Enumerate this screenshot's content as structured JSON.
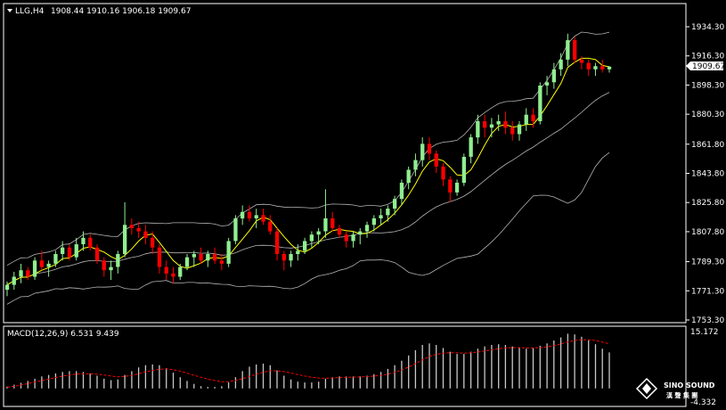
{
  "header": {
    "symbol": "LLG,H4",
    "ohlc": "1908.44 1910.16 1906.18 1909.67"
  },
  "price_axis": {
    "ticks": [
      "1934.30",
      "1916.30",
      "1898.30",
      "1880.30",
      "1861.80",
      "1843.80",
      "1825.80",
      "1807.80",
      "1789.30",
      "1771.30",
      "1753.30"
    ],
    "current_price": "1909.67"
  },
  "macd_panel": {
    "label": "MACD(12,26,9) 6.531 9.439",
    "top_label": "15.172",
    "bottom_label": "-4.332"
  },
  "watermark": {
    "brand": "SINO SOUND",
    "brand_cn": "漢 聲 集 團"
  },
  "colors": {
    "background": "#000000",
    "up_candle": "#90ee90",
    "down_candle": "#ff0000",
    "ma": "#ffff00",
    "bands": "#b4b4b4",
    "macd_hist": "#c8c8c8",
    "macd_signal": "#ff0000"
  },
  "chart_data": [
    {
      "type": "candlestick",
      "y_axis_range": [
        1753.3,
        1945.0
      ],
      "indicators": [
        "Moving Average",
        "Bollinger Bands"
      ],
      "candles": [
        [
          1772,
          1777,
          1768,
          1775
        ],
        [
          1775,
          1783,
          1772,
          1780
        ],
        [
          1780,
          1788,
          1776,
          1784
        ],
        [
          1784,
          1786,
          1778,
          1780
        ],
        [
          1780,
          1792,
          1778,
          1790
        ],
        [
          1790,
          1796,
          1784,
          1786
        ],
        [
          1786,
          1790,
          1780,
          1788
        ],
        [
          1788,
          1796,
          1786,
          1794
        ],
        [
          1794,
          1802,
          1790,
          1798
        ],
        [
          1798,
          1800,
          1790,
          1792
        ],
        [
          1792,
          1804,
          1790,
          1800
        ],
        [
          1800,
          1808,
          1796,
          1804
        ],
        [
          1804,
          1806,
          1796,
          1798
        ],
        [
          1798,
          1800,
          1788,
          1790
        ],
        [
          1790,
          1792,
          1780,
          1784
        ],
        [
          1784,
          1790,
          1778,
          1786
        ],
        [
          1786,
          1796,
          1782,
          1794
        ],
        [
          1794,
          1826,
          1792,
          1812
        ],
        [
          1812,
          1816,
          1806,
          1810
        ],
        [
          1810,
          1814,
          1804,
          1808
        ],
        [
          1808,
          1812,
          1800,
          1804
        ],
        [
          1804,
          1808,
          1794,
          1798
        ],
        [
          1798,
          1800,
          1782,
          1786
        ],
        [
          1786,
          1790,
          1778,
          1782
        ],
        [
          1782,
          1786,
          1776,
          1780
        ],
        [
          1780,
          1788,
          1778,
          1786
        ],
        [
          1786,
          1794,
          1784,
          1792
        ],
        [
          1792,
          1796,
          1786,
          1794
        ],
        [
          1794,
          1798,
          1788,
          1790
        ],
        [
          1790,
          1796,
          1786,
          1794
        ],
        [
          1794,
          1798,
          1788,
          1790
        ],
        [
          1790,
          1794,
          1784,
          1788
        ],
        [
          1788,
          1804,
          1786,
          1802
        ],
        [
          1802,
          1818,
          1800,
          1816
        ],
        [
          1816,
          1824,
          1812,
          1820
        ],
        [
          1820,
          1824,
          1814,
          1816
        ],
        [
          1816,
          1822,
          1810,
          1818
        ],
        [
          1818,
          1822,
          1812,
          1814
        ],
        [
          1814,
          1818,
          1806,
          1808
        ],
        [
          1808,
          1810,
          1790,
          1794
        ],
        [
          1794,
          1796,
          1784,
          1790
        ],
        [
          1790,
          1796,
          1786,
          1794
        ],
        [
          1794,
          1800,
          1790,
          1796
        ],
        [
          1796,
          1804,
          1794,
          1802
        ],
        [
          1802,
          1808,
          1798,
          1806
        ],
        [
          1806,
          1810,
          1800,
          1808
        ],
        [
          1808,
          1834,
          1804,
          1816
        ],
        [
          1816,
          1820,
          1808,
          1810
        ],
        [
          1810,
          1812,
          1804,
          1806
        ],
        [
          1806,
          1808,
          1798,
          1802
        ],
        [
          1802,
          1808,
          1798,
          1806
        ],
        [
          1806,
          1810,
          1800,
          1808
        ],
        [
          1808,
          1814,
          1804,
          1812
        ],
        [
          1812,
          1818,
          1808,
          1816
        ],
        [
          1816,
          1822,
          1812,
          1818
        ],
        [
          1818,
          1824,
          1814,
          1822
        ],
        [
          1822,
          1830,
          1818,
          1828
        ],
        [
          1828,
          1840,
          1824,
          1838
        ],
        [
          1838,
          1848,
          1834,
          1846
        ],
        [
          1846,
          1856,
          1842,
          1852
        ],
        [
          1852,
          1866,
          1848,
          1862
        ],
        [
          1862,
          1866,
          1852,
          1856
        ],
        [
          1856,
          1858,
          1844,
          1848
        ],
        [
          1848,
          1850,
          1836,
          1840
        ],
        [
          1840,
          1842,
          1826,
          1832
        ],
        [
          1832,
          1840,
          1830,
          1838
        ],
        [
          1838,
          1856,
          1836,
          1854
        ],
        [
          1854,
          1868,
          1850,
          1866
        ],
        [
          1866,
          1880,
          1862,
          1876
        ],
        [
          1876,
          1880,
          1866,
          1872
        ],
        [
          1872,
          1878,
          1866,
          1874
        ],
        [
          1874,
          1880,
          1870,
          1876
        ],
        [
          1876,
          1882,
          1868,
          1872
        ],
        [
          1872,
          1876,
          1864,
          1868
        ],
        [
          1868,
          1876,
          1864,
          1874
        ],
        [
          1874,
          1884,
          1870,
          1880
        ],
        [
          1880,
          1884,
          1872,
          1876
        ],
        [
          1876,
          1900,
          1874,
          1898
        ],
        [
          1898,
          1904,
          1892,
          1900
        ],
        [
          1900,
          1912,
          1896,
          1908
        ],
        [
          1908,
          1918,
          1904,
          1914
        ],
        [
          1914,
          1930,
          1910,
          1926
        ],
        [
          1926,
          1928,
          1912,
          1914
        ],
        [
          1914,
          1916,
          1908,
          1912
        ],
        [
          1912,
          1914,
          1904,
          1908
        ],
        [
          1908,
          1912,
          1904,
          1910
        ],
        [
          1910,
          1914,
          1906,
          1908
        ],
        [
          1908,
          1910,
          1906,
          1909.67
        ]
      ]
    },
    {
      "type": "bar",
      "title": "MACD(12,26,9)",
      "values": [
        0.5,
        1.0,
        1.5,
        2.0,
        2.6,
        3.2,
        3.6,
        4.0,
        4.4,
        4.6,
        4.6,
        4.4,
        4.0,
        3.4,
        2.6,
        2.2,
        2.4,
        3.6,
        4.6,
        5.6,
        6.2,
        6.4,
        6.2,
        5.4,
        4.2,
        3.0,
        2.0,
        1.2,
        0.6,
        0.4,
        0.4,
        0.6,
        1.6,
        3.0,
        4.6,
        5.8,
        6.4,
        6.6,
        6.2,
        4.8,
        3.4,
        2.4,
        1.8,
        1.6,
        1.6,
        1.8,
        2.6,
        3.0,
        3.2,
        3.2,
        3.2,
        3.2,
        3.4,
        3.8,
        4.4,
        5.2,
        6.2,
        7.4,
        8.8,
        10.2,
        11.6,
        12.0,
        11.6,
        10.8,
        9.8,
        9.2,
        9.2,
        9.8,
        10.6,
        11.2,
        11.6,
        11.8,
        11.6,
        11.2,
        10.8,
        10.6,
        10.8,
        11.4,
        12.0,
        12.8,
        13.6,
        14.6,
        14.4,
        13.8,
        12.8,
        11.8,
        10.6,
        9.6
      ],
      "signal": [
        0.3,
        0.6,
        0.9,
        1.3,
        1.7,
        2.1,
        2.5,
        2.9,
        3.3,
        3.6,
        3.8,
        3.9,
        3.9,
        3.8,
        3.6,
        3.3,
        3.1,
        3.2,
        3.5,
        3.9,
        4.4,
        4.8,
        5.1,
        5.2,
        5.0,
        4.6,
        4.1,
        3.5,
        3.0,
        2.5,
        2.1,
        1.8,
        1.8,
        2.1,
        2.6,
        3.2,
        3.8,
        4.3,
        4.7,
        4.7,
        4.5,
        4.1,
        3.7,
        3.3,
        3.0,
        2.8,
        2.7,
        2.8,
        2.9,
        3.0,
        3.0,
        3.1,
        3.1,
        3.3,
        3.5,
        3.8,
        4.3,
        4.9,
        5.7,
        6.6,
        7.6,
        8.5,
        9.1,
        9.4,
        9.5,
        9.5,
        9.4,
        9.5,
        9.7,
        10.0,
        10.3,
        10.6,
        10.8,
        10.9,
        10.9,
        10.8,
        10.8,
        10.9,
        11.1,
        11.4,
        11.9,
        12.4,
        12.8,
        13.0,
        13.0,
        12.8,
        12.4,
        11.9
      ]
    }
  ]
}
